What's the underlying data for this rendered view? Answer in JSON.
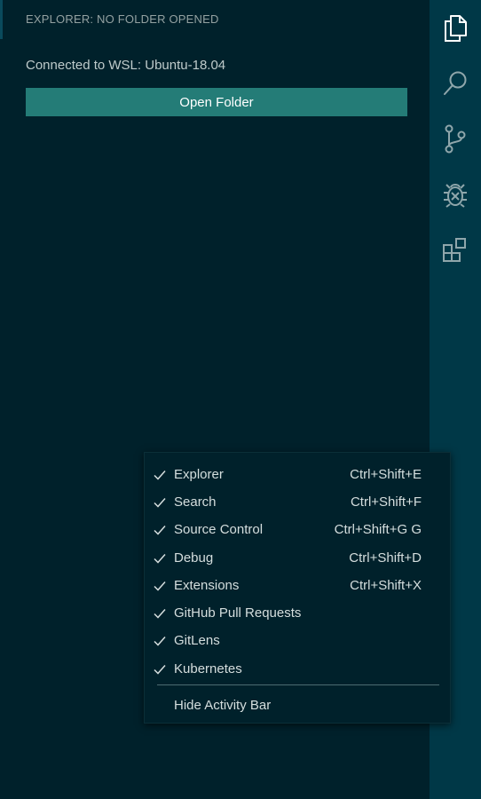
{
  "sidebar": {
    "title": "EXPLORER: NO FOLDER OPENED",
    "connection_text": "Connected to WSL: Ubuntu-18.04",
    "open_folder_label": "Open Folder"
  },
  "activity_bar": {
    "icons": [
      "files-icon",
      "search-icon",
      "source-control-icon",
      "debug-icon",
      "extensions-icon"
    ]
  },
  "context_menu": {
    "items": [
      {
        "label": "Explorer",
        "shortcut": "Ctrl+Shift+E",
        "checked": true
      },
      {
        "label": "Search",
        "shortcut": "Ctrl+Shift+F",
        "checked": true
      },
      {
        "label": "Source Control",
        "shortcut": "Ctrl+Shift+G G",
        "checked": true
      },
      {
        "label": "Debug",
        "shortcut": "Ctrl+Shift+D",
        "checked": true
      },
      {
        "label": "Extensions",
        "shortcut": "Ctrl+Shift+X",
        "checked": true
      },
      {
        "label": "GitHub Pull Requests",
        "shortcut": "",
        "checked": true
      },
      {
        "label": "GitLens",
        "shortcut": "",
        "checked": true
      },
      {
        "label": "Kubernetes",
        "shortcut": "",
        "checked": true
      }
    ],
    "hide_label": "Hide Activity Bar"
  },
  "colors": {
    "sidebar_bg": "#00212b",
    "activity_bar_bg": "#003847",
    "button_bg": "#247c77",
    "text": "#d5dede"
  }
}
